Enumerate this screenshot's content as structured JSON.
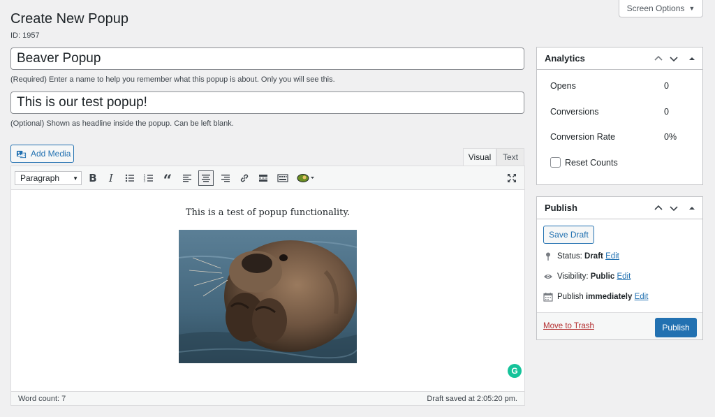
{
  "page": {
    "title": "Create New Popup",
    "post_id": "ID: 1957",
    "screen_options": "Screen Options"
  },
  "form": {
    "title_value": "Beaver Popup",
    "title_help": "(Required) Enter a name to help you remember what this popup is about. Only you will see this.",
    "headline_value": "This is our test popup!",
    "headline_help": "(Optional) Shown as headline inside the popup. Can be left blank."
  },
  "editor": {
    "add_media": "Add Media",
    "tabs": [
      "Visual",
      "Text"
    ],
    "active_tab": "Visual",
    "format_select": "Paragraph",
    "toolbar_icons": [
      "bold-icon",
      "italic-icon",
      "bullet-list-icon",
      "numbered-list-icon",
      "blockquote-icon",
      "align-left-icon",
      "align-center-icon",
      "align-right-icon",
      "link-icon",
      "read-more-icon",
      "toolbar-toggle-icon",
      "popup-plugin-icon",
      "fullscreen-icon"
    ],
    "content_text": "This is a test of popup functionality.",
    "word_count": "Word count: 7",
    "draft_saved": "Draft saved at 2:05:20 pm."
  },
  "analytics": {
    "title": "Analytics",
    "rows": [
      {
        "label": "Opens",
        "value": "0"
      },
      {
        "label": "Conversions",
        "value": "0"
      },
      {
        "label": "Conversion Rate",
        "value": "0%"
      }
    ],
    "reset_label": "Reset Counts"
  },
  "publish": {
    "title": "Publish",
    "save_draft": "Save Draft",
    "status_label": "Status:",
    "status_value": "Draft",
    "visibility_label": "Visibility:",
    "visibility_value": "Public",
    "publish_label": "Publish",
    "publish_value": "immediately",
    "edit_link": "Edit",
    "trash_link": "Move to Trash",
    "publish_button": "Publish"
  },
  "colors": {
    "accent": "#2271b1",
    "danger": "#b32d2e",
    "grammarly": "#15c39a"
  }
}
